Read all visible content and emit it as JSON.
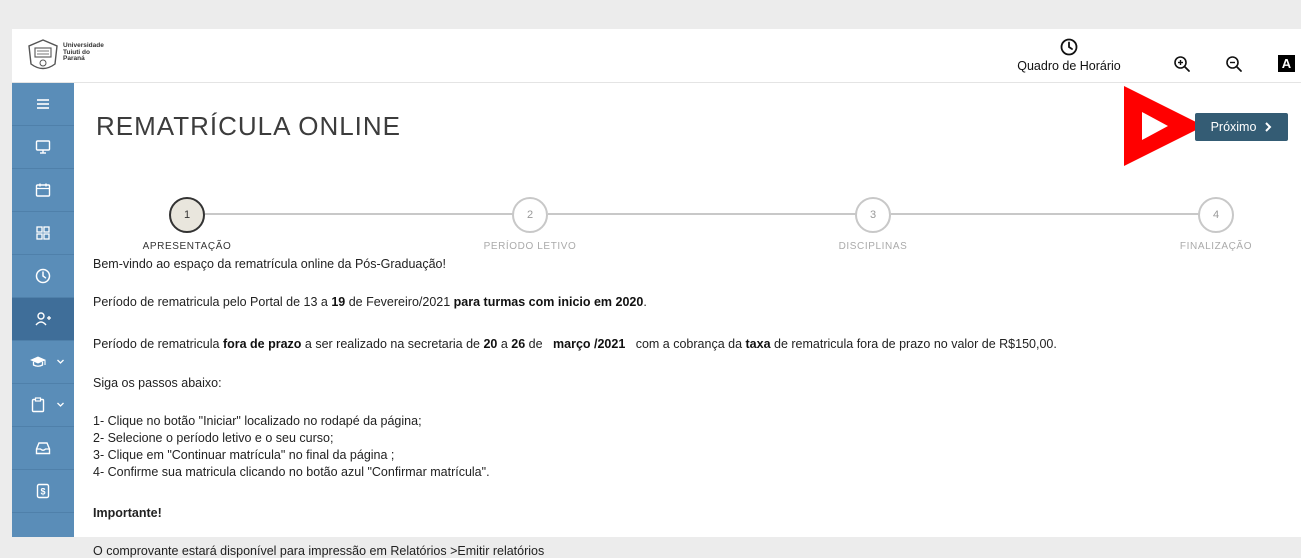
{
  "header": {
    "logo_lines": [
      "Universidade",
      "Tuiuti do",
      "Paraná"
    ],
    "schedule_label": "Quadro de Horário",
    "font_toggle_label": "A"
  },
  "sidebar": {
    "items": [
      {
        "icon": "menu-icon"
      },
      {
        "icon": "monitor-icon"
      },
      {
        "icon": "calendar-icon"
      },
      {
        "icon": "grid-icon"
      },
      {
        "icon": "clock-icon"
      },
      {
        "icon": "add-user-icon",
        "active": true
      },
      {
        "icon": "graduation-cap-icon",
        "dropdown": true
      },
      {
        "icon": "clipboard-icon",
        "dropdown": true
      },
      {
        "icon": "inbox-icon"
      },
      {
        "icon": "payment-icon"
      }
    ]
  },
  "main": {
    "title": "REMATRÍCULA ONLINE",
    "next_label": "Próximo"
  },
  "steps": [
    {
      "number": "1",
      "label": "APRESENTAÇÃO",
      "active": true
    },
    {
      "number": "2",
      "label": "PERÍODO LETIVO",
      "active": false
    },
    {
      "number": "3",
      "label": "DISCIPLINAS",
      "active": false
    },
    {
      "number": "4",
      "label": "FINALIZAÇÃO",
      "active": false
    }
  ],
  "content": {
    "welcome": "Bem-vindo ao espaço da rematrícula online da Pós-Graduação!",
    "period": {
      "a": "Período de rematricula pelo Portal de 13 a ",
      "b": "19",
      "c": " de Fevereiro/2021 ",
      "d": "para turmas com inicio em 2020",
      "e": "."
    },
    "late": {
      "a": "Período de rematricula ",
      "b": "fora de prazo",
      "c": " a ser realizado na secretaria de ",
      "d": "20",
      "e": " a ",
      "f": "26",
      "g": " de ",
      "h": "março /2021",
      "i": " com a cobrança da ",
      "j": "taxa",
      "k": " de rematricula fora de prazo no valor de R$150,00."
    },
    "steps_intro": "Siga os passos abaixo:",
    "step_list": [
      "1- Clique no botão  \"Iniciar\" localizado no rodapé da página;",
      "2- Selecione o período letivo e o seu curso;",
      "3- Clique em \"Continuar matrícula\" no final da página ;",
      "4- Confirme sua matricula clicando  no botão azul  \"Confirmar matrícula\"."
    ],
    "important": "Importante!",
    "receipt": "O comprovante estará disponível para impressão em Relatórios >Emitir relatórios"
  },
  "colors": {
    "sidebar": "#5a8db8",
    "sidebar_active": "#3f6e99",
    "next_button": "#345c74",
    "annotation_arrow": "#ff0000"
  }
}
